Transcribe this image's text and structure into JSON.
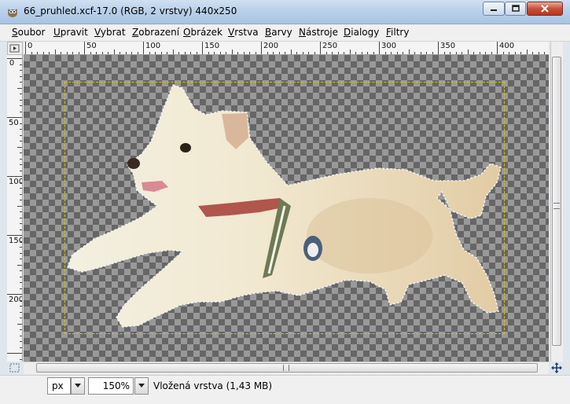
{
  "window": {
    "title": "66_pruhled.xcf-17.0 (RGB, 2 vrstvy) 440x250"
  },
  "menu": {
    "items": [
      {
        "u": "S",
        "rest": "oubor"
      },
      {
        "u": "U",
        "rest": "pravit"
      },
      {
        "u": "V",
        "rest": "ybrat"
      },
      {
        "u": "Z",
        "rest": "obrazení"
      },
      {
        "u": "O",
        "rest": "brázek"
      },
      {
        "u": "V",
        "rest": "rstva"
      },
      {
        "u": "B",
        "rest": "arvy"
      },
      {
        "u": "N",
        "rest": "ástroje"
      },
      {
        "u": "D",
        "rest": "ialogy"
      },
      {
        "u": "F",
        "rest": "iltry"
      }
    ]
  },
  "ruler": {
    "horizontal_labels": [
      "0",
      "50",
      "100",
      "150",
      "200",
      "250",
      "300",
      "350",
      "400"
    ],
    "vertical_labels": [
      "0",
      "50",
      "100",
      "150",
      "200"
    ]
  },
  "status": {
    "unit": "px",
    "zoom": "150%",
    "message": "Vložená vrstva (1,43 MB)"
  },
  "colors": {
    "selection_outline": "#d8c400",
    "checker_dark": "#666666",
    "checker_light": "#999999"
  },
  "icons": {
    "app": "gimp-wilber-icon",
    "minimize": "minimize-icon",
    "maximize": "maximize-icon",
    "close": "close-icon",
    "ruler_corner": "menu-arrow-icon",
    "quick_mask": "quick-mask-icon",
    "navigate": "navigate-cross-icon",
    "dropdown": "chevron-down-icon"
  }
}
